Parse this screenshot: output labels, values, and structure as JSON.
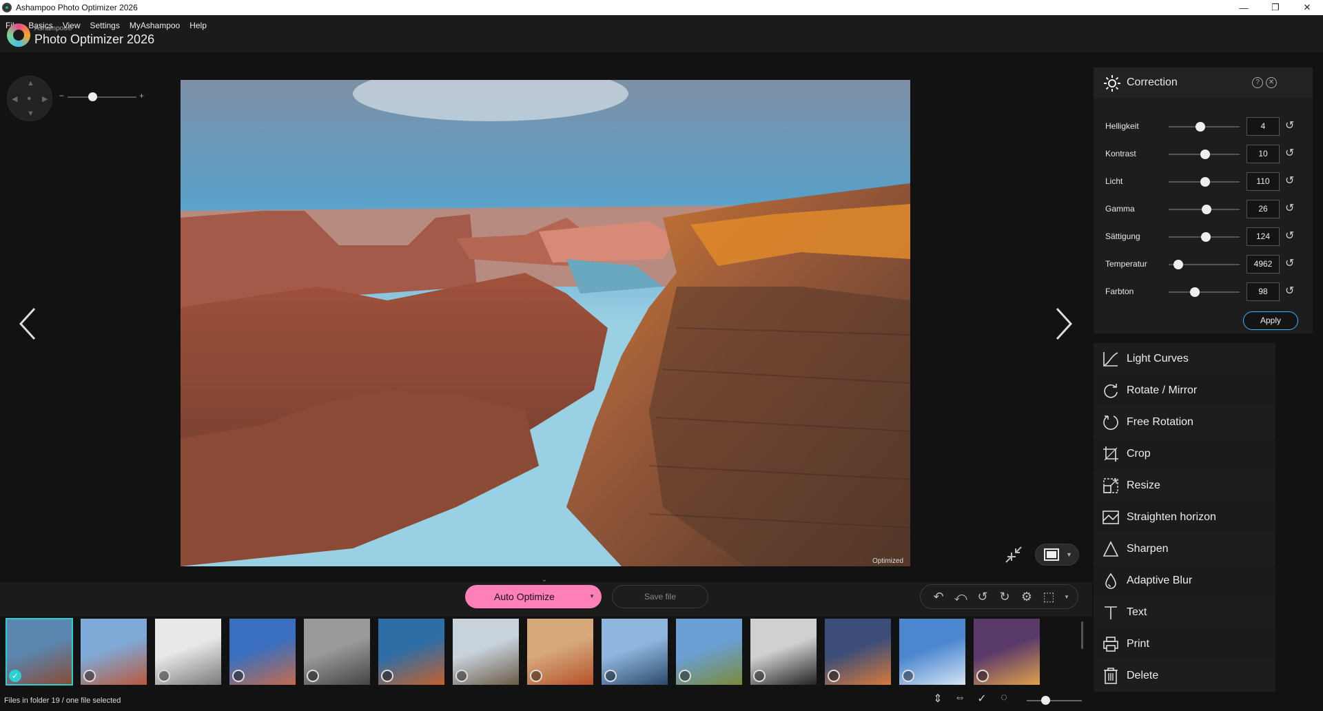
{
  "window": {
    "title": "Ashampoo Photo Optimizer 2026",
    "controls": [
      "—",
      "❐",
      "✕"
    ]
  },
  "menu": [
    "File",
    "Basics",
    "View",
    "Settings",
    "MyAshampoo",
    "Help"
  ],
  "brand": {
    "small": "Ashampoo®",
    "big": "Photo Optimizer 2026"
  },
  "image": {
    "overlay_label": "Optimized"
  },
  "actions": {
    "auto_optimize": "Auto Optimize",
    "save_file": "Save file"
  },
  "correction": {
    "title": "Correction",
    "help": "?",
    "close": "✕",
    "apply": "Apply",
    "sliders": [
      {
        "label": "Helligkeit",
        "value": "4",
        "pos": 0.45
      },
      {
        "label": "Kontrast",
        "value": "10",
        "pos": 0.51
      },
      {
        "label": "Licht",
        "value": "110",
        "pos": 0.51
      },
      {
        "label": "Gamma",
        "value": "26",
        "pos": 0.53
      },
      {
        "label": "Sättigung",
        "value": "124",
        "pos": 0.52
      },
      {
        "label": "Temperatur",
        "value": "4962",
        "pos": 0.14
      },
      {
        "label": "Farbton",
        "value": "98",
        "pos": 0.37
      }
    ]
  },
  "tools": [
    {
      "label": "Light Curves",
      "icon": "curve-icon"
    },
    {
      "label": "Rotate / Mirror",
      "icon": "rotate-mirror-icon"
    },
    {
      "label": "Free Rotation",
      "icon": "free-rotation-icon"
    },
    {
      "label": "Crop",
      "icon": "crop-icon"
    },
    {
      "label": "Resize",
      "icon": "resize-icon"
    },
    {
      "label": "Straighten horizon",
      "icon": "straighten-icon"
    },
    {
      "label": "Sharpen",
      "icon": "sharpen-icon"
    },
    {
      "label": "Adaptive Blur",
      "icon": "blur-icon"
    },
    {
      "label": "Text",
      "icon": "text-icon"
    },
    {
      "label": "Print",
      "icon": "print-icon"
    },
    {
      "label": "Delete",
      "icon": "delete-icon"
    }
  ],
  "status": {
    "text": "Files in folder 19 / one file selected",
    "zoom_level": 0.34
  },
  "thumbnails": [
    {
      "c1": "#5a86b0",
      "c2": "#8a4a32",
      "selected": true
    },
    {
      "c1": "#7fa9d6",
      "c2": "#b9583c",
      "selected": false
    },
    {
      "c1": "#e8e8e8",
      "c2": "#7a7a7a",
      "selected": false
    },
    {
      "c1": "#3a6fbf",
      "c2": "#c46b4a",
      "selected": false
    },
    {
      "c1": "#9a9a9a",
      "c2": "#444444",
      "selected": false
    },
    {
      "c1": "#2e6ea6",
      "c2": "#c4612d",
      "selected": false
    },
    {
      "c1": "#c7d2db",
      "c2": "#6b5a48",
      "selected": false
    },
    {
      "c1": "#d6a87a",
      "c2": "#b5512a",
      "selected": false
    },
    {
      "c1": "#8fb6de",
      "c2": "#2b4a6a",
      "selected": false
    },
    {
      "c1": "#6aa0d4",
      "c2": "#7a8a3a",
      "selected": false
    },
    {
      "c1": "#d0d0d0",
      "c2": "#222222",
      "selected": false
    },
    {
      "c1": "#3b4d78",
      "c2": "#d87a3a",
      "selected": false
    },
    {
      "c1": "#4c86d0",
      "c2": "#d4e4f4",
      "selected": false
    },
    {
      "c1": "#5a3a6a",
      "c2": "#e2a04a",
      "selected": false
    }
  ],
  "colors": {
    "accent": "#2bd0d0",
    "primary_button": "#ff7fb8",
    "apply_border": "#3ab5ff"
  }
}
